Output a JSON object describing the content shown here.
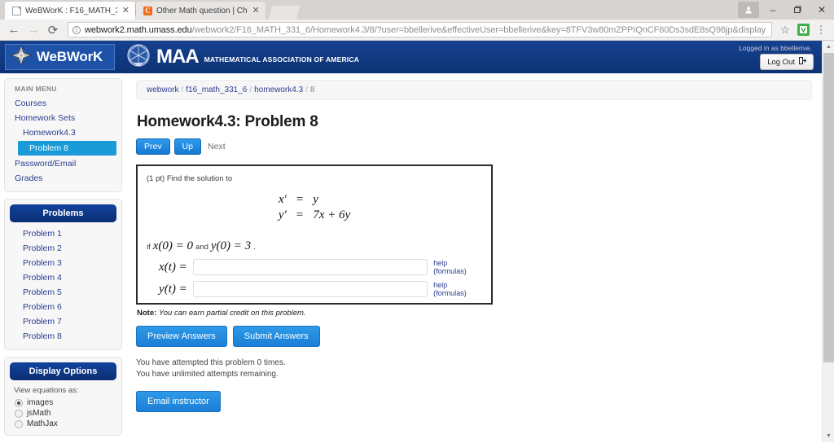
{
  "browser": {
    "tabs": [
      {
        "title": "WeBWorK : F16_MATH_3",
        "favicon": "page-icon",
        "active": true,
        "close_label": "✕"
      },
      {
        "title": "Other Math question | Ch",
        "favicon": "chegg-c-icon",
        "favicon_text": "C",
        "active": false,
        "close_label": "✕"
      }
    ],
    "nav": {
      "back": "←",
      "forward": "→",
      "reload": "⟳"
    },
    "omnibox": {
      "info_icon": "i",
      "url_host": "webwork2.math.umass.edu",
      "url_path": "/webwork2/F16_MATH_331_6/Homework4.3/8/?user=bbellerive&effectiveUser=bbellerive&key=8TFV3w80mZPPIQnCF60Ds3sdE8sQ98jp&display",
      "bookmark_icon": "☆",
      "extension_icon": "▼",
      "menu_icon": "⋮"
    },
    "window_controls": {
      "profile_icon": "▲",
      "minimize": "–",
      "maximize": "❐",
      "close": "✕"
    }
  },
  "ww_header": {
    "logo_text": "WeBWorK",
    "logo_icon": "webwork-star-icon",
    "maa_text": "MAA",
    "maa_icon": "maa-polyhedron-icon",
    "maa_subtitle": "MATHEMATICAL ASSOCIATION OF AMERICA",
    "logged_in_text": "Logged in as bbellerive.",
    "logout_label": "Log Out",
    "logout_icon": "↦"
  },
  "sidebar": {
    "main_menu": {
      "heading": "MAIN MENU",
      "items": [
        {
          "label": "Courses",
          "level": 1,
          "active": false
        },
        {
          "label": "Homework Sets",
          "level": 1,
          "active": false
        },
        {
          "label": "Homework4.3",
          "level": 2,
          "active": false
        },
        {
          "label": "Problem 8",
          "level": 3,
          "active": true
        },
        {
          "label": "Password/Email",
          "level": 1,
          "active": false
        },
        {
          "label": "Grades",
          "level": 1,
          "active": false
        }
      ]
    },
    "problems": {
      "title": "Problems",
      "items": [
        {
          "label": "Problem 1"
        },
        {
          "label": "Problem 2"
        },
        {
          "label": "Problem 3"
        },
        {
          "label": "Problem 4"
        },
        {
          "label": "Problem 5"
        },
        {
          "label": "Problem 6"
        },
        {
          "label": "Problem 7"
        },
        {
          "label": "Problem 8"
        }
      ]
    },
    "display_options": {
      "title": "Display Options",
      "radio_group_label": "View equations as:",
      "options": [
        {
          "label": "images",
          "selected": true
        },
        {
          "label": "jsMath",
          "selected": false
        },
        {
          "label": "MathJax",
          "selected": false
        }
      ]
    }
  },
  "main": {
    "breadcrumb": [
      {
        "label": "webwork",
        "link": true
      },
      {
        "label": "f16_math_331_6",
        "link": true
      },
      {
        "label": "homework4.3",
        "link": true
      },
      {
        "label": "8",
        "link": false
      }
    ],
    "breadcrumb_separator": "/",
    "page_title": "Homework4.3: Problem 8",
    "pager": {
      "prev": "Prev",
      "up": "Up",
      "next": "Next"
    },
    "problem": {
      "points": "(1 pt)",
      "prompt": "Find the solution to",
      "system": [
        {
          "lhs": "x′",
          "eq": "=",
          "rhs": "y"
        },
        {
          "lhs": "y′",
          "eq": "=",
          "rhs": "7x + 6y"
        }
      ],
      "condition_prefix": "if",
      "condition_1": "x(0) = 0",
      "condition_join": "and",
      "condition_2": "y(0) = 3",
      "condition_suffix": ".",
      "answers": [
        {
          "label": "x(t) =",
          "value": "",
          "help": "help (formulas)"
        },
        {
          "label": "y(t) =",
          "value": "",
          "help": "help (formulas)"
        }
      ]
    },
    "note_label": "Note:",
    "note_text": "You can earn partial credit on this problem.",
    "preview_label": "Preview Answers",
    "submit_label": "Submit Answers",
    "attempts_line_1": "You have attempted this problem 0 times.",
    "attempts_line_2": "You have unlimited attempts remaining.",
    "email_label": "Email instructor"
  },
  "scrollbar": {
    "up_arrow": "▲",
    "down_arrow": "▼"
  },
  "colors": {
    "ww_navy": "#0f3d8c",
    "accent_blue": "#1a9bd7",
    "link_navy": "#2b3d8f",
    "button_blue": "#1c7fd6"
  }
}
